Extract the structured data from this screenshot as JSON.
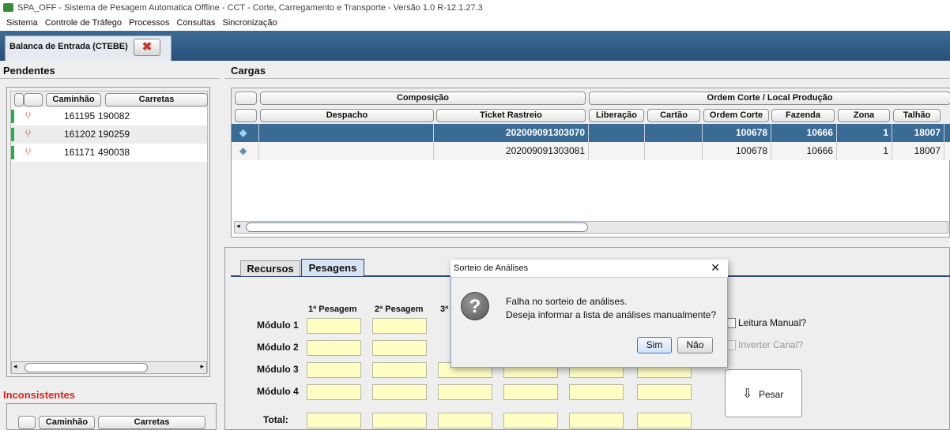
{
  "window": {
    "title": "SPA_OFF - Sistema de Pesagem Automatica Offline - CCT - Corte, Carregamento e Transporte - Versão 1.0 R-12.1.27.3"
  },
  "menu": [
    "Sistema",
    "Controle de Tráfego",
    "Processos",
    "Consultas",
    "Sincronização"
  ],
  "tab": {
    "label": "Balanca de Entrada (CTEBE)",
    "close": "✖"
  },
  "pendentes": {
    "title": "Pendentes",
    "columns": [
      "Caminhão",
      "Carretas"
    ],
    "rows": [
      {
        "caminhao": "161195",
        "carretas": "190082"
      },
      {
        "caminhao": "161202",
        "carretas": "190259"
      },
      {
        "caminhao": "161171",
        "carretas": "490038"
      }
    ]
  },
  "inconsistentes": {
    "title": "Inconsistentes",
    "columns": [
      "Caminhão",
      "Carretas"
    ]
  },
  "cargas": {
    "title": "Cargas",
    "group_headers": [
      "Composição",
      "Ordem Corte / Local Produção"
    ],
    "columns": [
      "Despacho",
      "Ticket Rastreio",
      "Liberação",
      "Cartão",
      "Ordem Corte",
      "Fazenda",
      "Zona",
      "Talhão"
    ],
    "rows": [
      {
        "despacho": "",
        "ticket": "202009091303070",
        "liberacao": "",
        "cartao": "",
        "ordem": "100678",
        "fazenda": "10666",
        "zona": "1",
        "talhao": "18007"
      },
      {
        "despacho": "",
        "ticket": "202009091303081",
        "liberacao": "",
        "cartao": "",
        "ordem": "100678",
        "fazenda": "10666",
        "zona": "1",
        "talhao": "18007"
      }
    ]
  },
  "subtabs": [
    "Recursos",
    "Pesagens"
  ],
  "pesagens": {
    "col_headers": [
      "1ª Pesagem",
      "2ª Pesagem",
      "3ª"
    ],
    "row_labels": [
      "Módulo 1",
      "Módulo 2",
      "Módulo 3",
      "Módulo 4",
      "Total:"
    ],
    "leitura_manual": "Leitura Manual?",
    "inverter_canal": "Inverter Canal?",
    "pesar": "Pesar"
  },
  "dialog": {
    "title": "Sorteio de Análises",
    "close": "✕",
    "line1": "Falha no sorteio de análises.",
    "line2": "Deseja informar a lista de análises manualmente?",
    "yes": "Sim",
    "no": "Não"
  }
}
